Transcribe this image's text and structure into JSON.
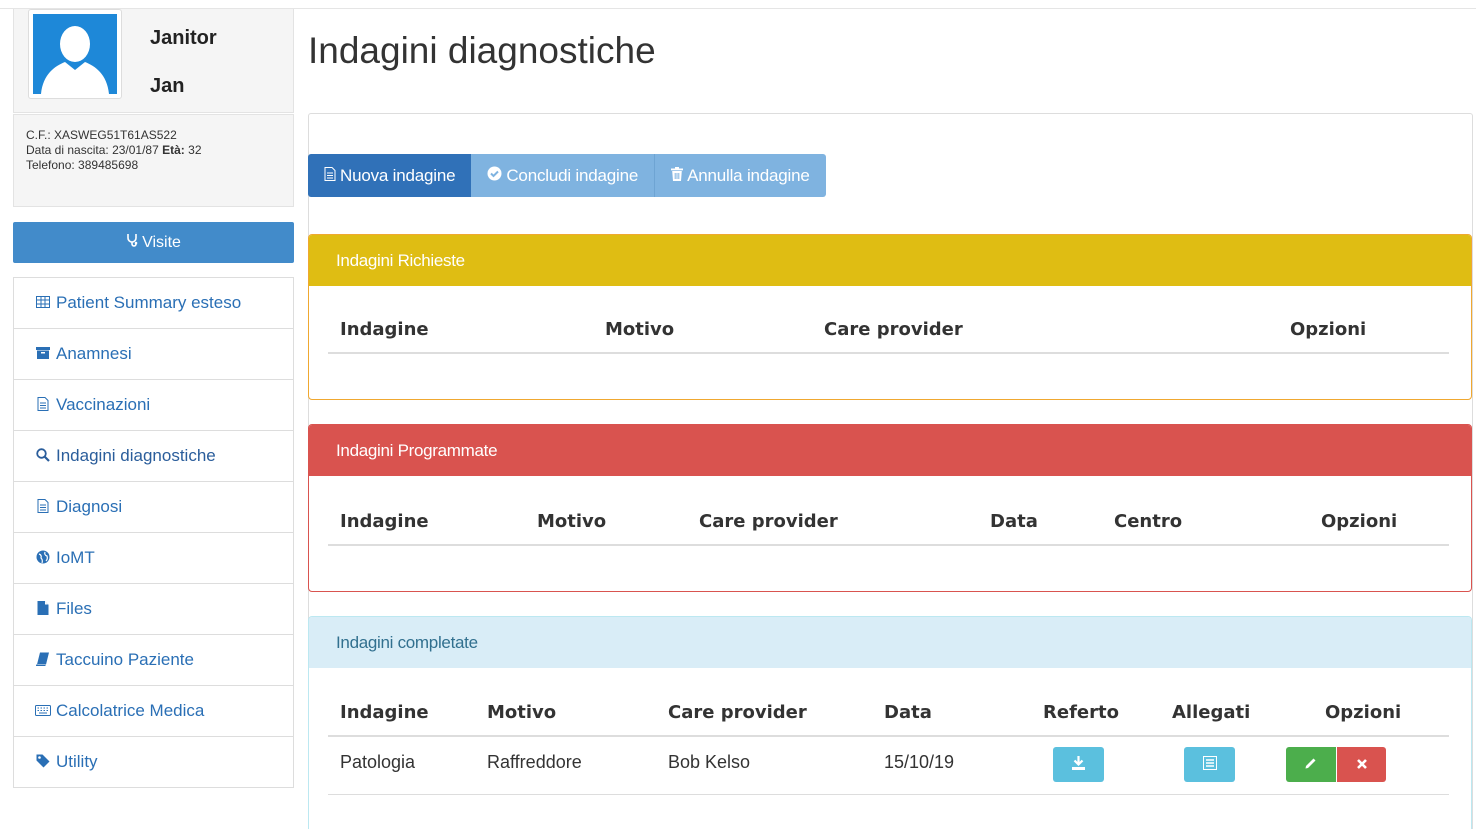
{
  "patient": {
    "first_name": "Janitor",
    "last_name": "Jan",
    "cf_label": "C.F.:",
    "cf_value": "XASWEG51T61AS522",
    "birth_label": "Data di nascita:",
    "birth_value": "23/01/87",
    "age_label": "Età:",
    "age_value": "32",
    "phone_label": "Telefono:",
    "phone_value": "389485698"
  },
  "sidebar": {
    "visite_label": "Visite",
    "items": [
      {
        "label": "Patient Summary esteso",
        "icon": "table-icon"
      },
      {
        "label": "Anamnesi",
        "icon": "archive-icon"
      },
      {
        "label": "Vaccinazioni",
        "icon": "document-icon"
      },
      {
        "label": "Indagini diagnostiche",
        "icon": "search-icon"
      },
      {
        "label": "Diagnosi",
        "icon": "document-icon"
      },
      {
        "label": "IoMT",
        "icon": "globe-icon"
      },
      {
        "label": "Files",
        "icon": "file-icon"
      },
      {
        "label": "Taccuino Paziente",
        "icon": "book-icon"
      },
      {
        "label": "Calcolatrice Medica",
        "icon": "keyboard-icon"
      },
      {
        "label": "Utility",
        "icon": "tag-icon"
      }
    ]
  },
  "main": {
    "title": "Indagini diagnostiche",
    "buttons": {
      "new": "Nuova indagine",
      "conclude": "Concludi indagine",
      "cancel": "Annulla indagine"
    },
    "richieste": {
      "title": "Indagini Richieste",
      "columns": [
        "Indagine",
        "Motivo",
        "Care provider",
        "Opzioni"
      ]
    },
    "programmate": {
      "title": "Indagini Programmate",
      "columns": [
        "Indagine",
        "Motivo",
        "Care provider",
        "Data",
        "Centro",
        "Opzioni"
      ]
    },
    "completate": {
      "title": "Indagini completate",
      "columns": [
        "Indagine",
        "Motivo",
        "Care provider",
        "Data",
        "Referto",
        "Allegati",
        "Opzioni"
      ],
      "rows": [
        {
          "indagine": "Patologia",
          "motivo": "Raffreddore",
          "care_provider": "Bob Kelso",
          "data": "15/10/19"
        }
      ]
    }
  },
  "colors": {
    "primary": "#3071b8",
    "warning_header": "#dfbd13",
    "danger": "#d9534f",
    "info_header": "#d9edf7",
    "success": "#4cae4c",
    "info_button": "#5bc0de"
  }
}
